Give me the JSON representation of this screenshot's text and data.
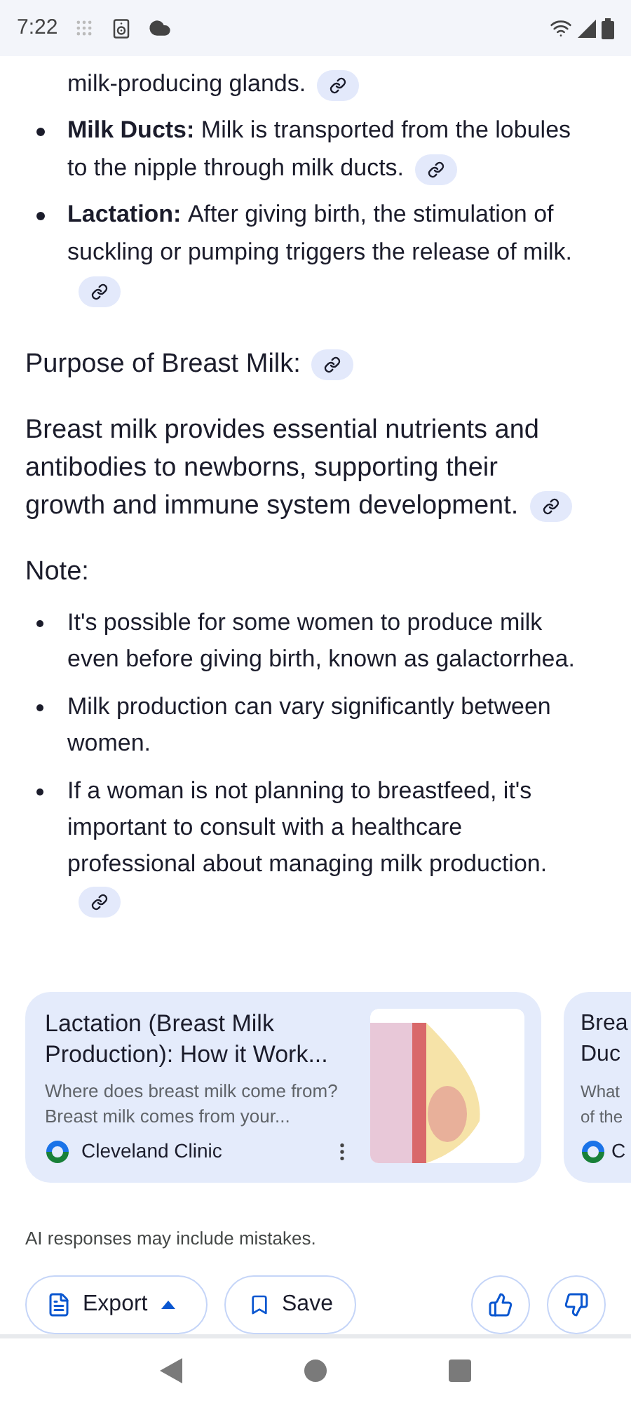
{
  "status_bar": {
    "time": "7:22"
  },
  "top_list": [
    {
      "kind": "continuation",
      "text": "milk-producing glands.",
      "link": true
    },
    {
      "kind": "bullet",
      "bold": "Milk Ducts:",
      "text": "Milk is transported from the lobules to the nipple through milk ducts.",
      "link": true
    },
    {
      "kind": "bullet",
      "bold": "Lactation:",
      "text": "After giving birth, the stimulation of suckling or pumping triggers the release of milk.",
      "link": true
    }
  ],
  "purpose_heading": {
    "text": "Purpose of Breast Milk:",
    "link": true
  },
  "purpose_paragraph": {
    "text": "Breast milk provides essential nutrients and antibodies to newborns, supporting their growth and immune system development.",
    "link": true
  },
  "note_heading": "Note:",
  "note_list": [
    {
      "text": "It's possible for some women to produce milk even before giving birth, known as galactorrhea.",
      "link": false
    },
    {
      "text": "Milk production can vary significantly between women.",
      "link": false
    },
    {
      "text": "If a woman is not planning to breastfeed, it's important to consult with a healthcare professional about managing milk production.",
      "link": true
    }
  ],
  "source_cards": [
    {
      "title": "Lactation (Breast Milk Production): How it Work...",
      "snippet": "Where does breast milk come from? Breast milk comes from your...",
      "source": "Cleveland Clinic",
      "kind": "full"
    },
    {
      "title": "Brea Duc",
      "snippet": "What of the",
      "source": "C",
      "kind": "partial"
    }
  ],
  "disclaimer": "AI responses may include mistakes.",
  "actions": [
    {
      "kind": "export",
      "label": "Export"
    },
    {
      "kind": "save",
      "label": "Save"
    }
  ]
}
